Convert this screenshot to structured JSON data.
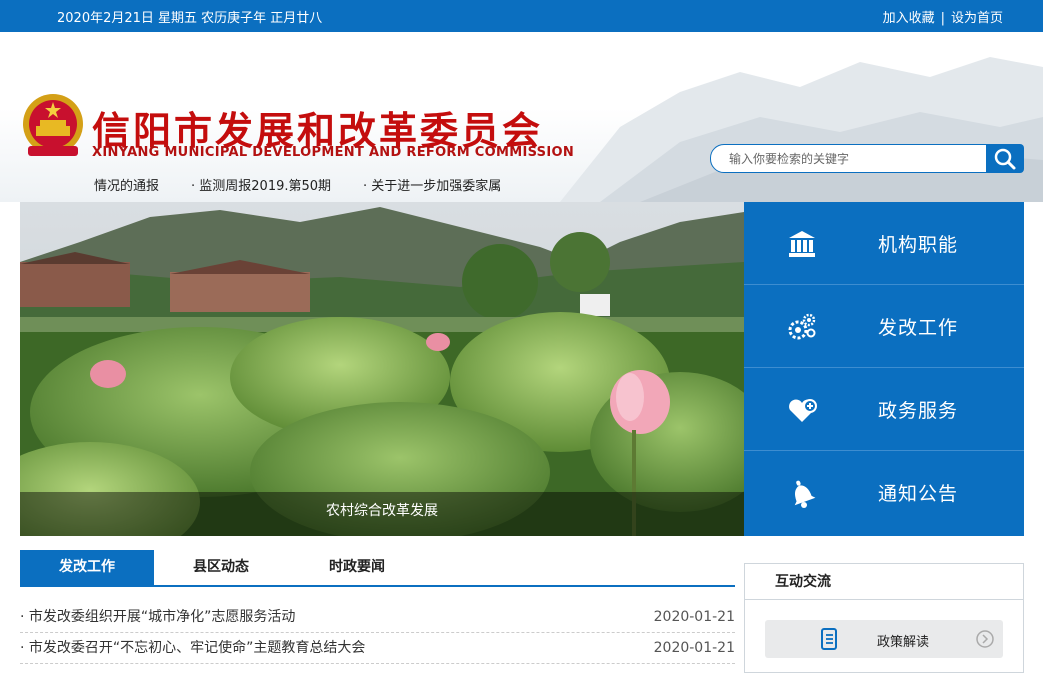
{
  "topbar": {
    "date": "2020年2月21日 星期五 农历庚子年 正月廿八",
    "add_favorite": "加入收藏",
    "separator": "|",
    "set_homepage": "设为首页"
  },
  "header": {
    "site_title_cn": "信阳市发展和改革委员会",
    "site_title_en": "XINYANG MUNICIPAL DEVELOPMENT AND REFORM COMMISSION",
    "search_placeholder": "输入你要检索的关键字"
  },
  "ticker": {
    "items": [
      "情况的通报",
      "· 监测周报2019.第50期",
      "· 关于进一步加强委家属"
    ]
  },
  "banner": {
    "caption": "农村综合改革发展"
  },
  "quick_links": [
    {
      "label": "机构职能",
      "icon": "institution-icon"
    },
    {
      "label": "发改工作",
      "icon": "gears-icon"
    },
    {
      "label": "政务服务",
      "icon": "heart-service-icon"
    },
    {
      "label": "通知公告",
      "icon": "bell-icon"
    }
  ],
  "tabs": [
    {
      "label": "发改工作",
      "active": true
    },
    {
      "label": "县区动态",
      "active": false
    },
    {
      "label": "时政要闻",
      "active": false
    }
  ],
  "news": [
    {
      "title": "· 市发改委组织开展“城市净化”志愿服务活动",
      "date": "2020-01-21"
    },
    {
      "title": "· 市发改委召开“不忘初心、牢记使命”主题教育总结大会",
      "date": "2020-01-21"
    }
  ],
  "interact": {
    "title": "互动交流",
    "items": [
      {
        "label": "政策解读"
      }
    ]
  },
  "colors": {
    "primary": "#0b6fc0",
    "title_red": "#c40d0d"
  }
}
